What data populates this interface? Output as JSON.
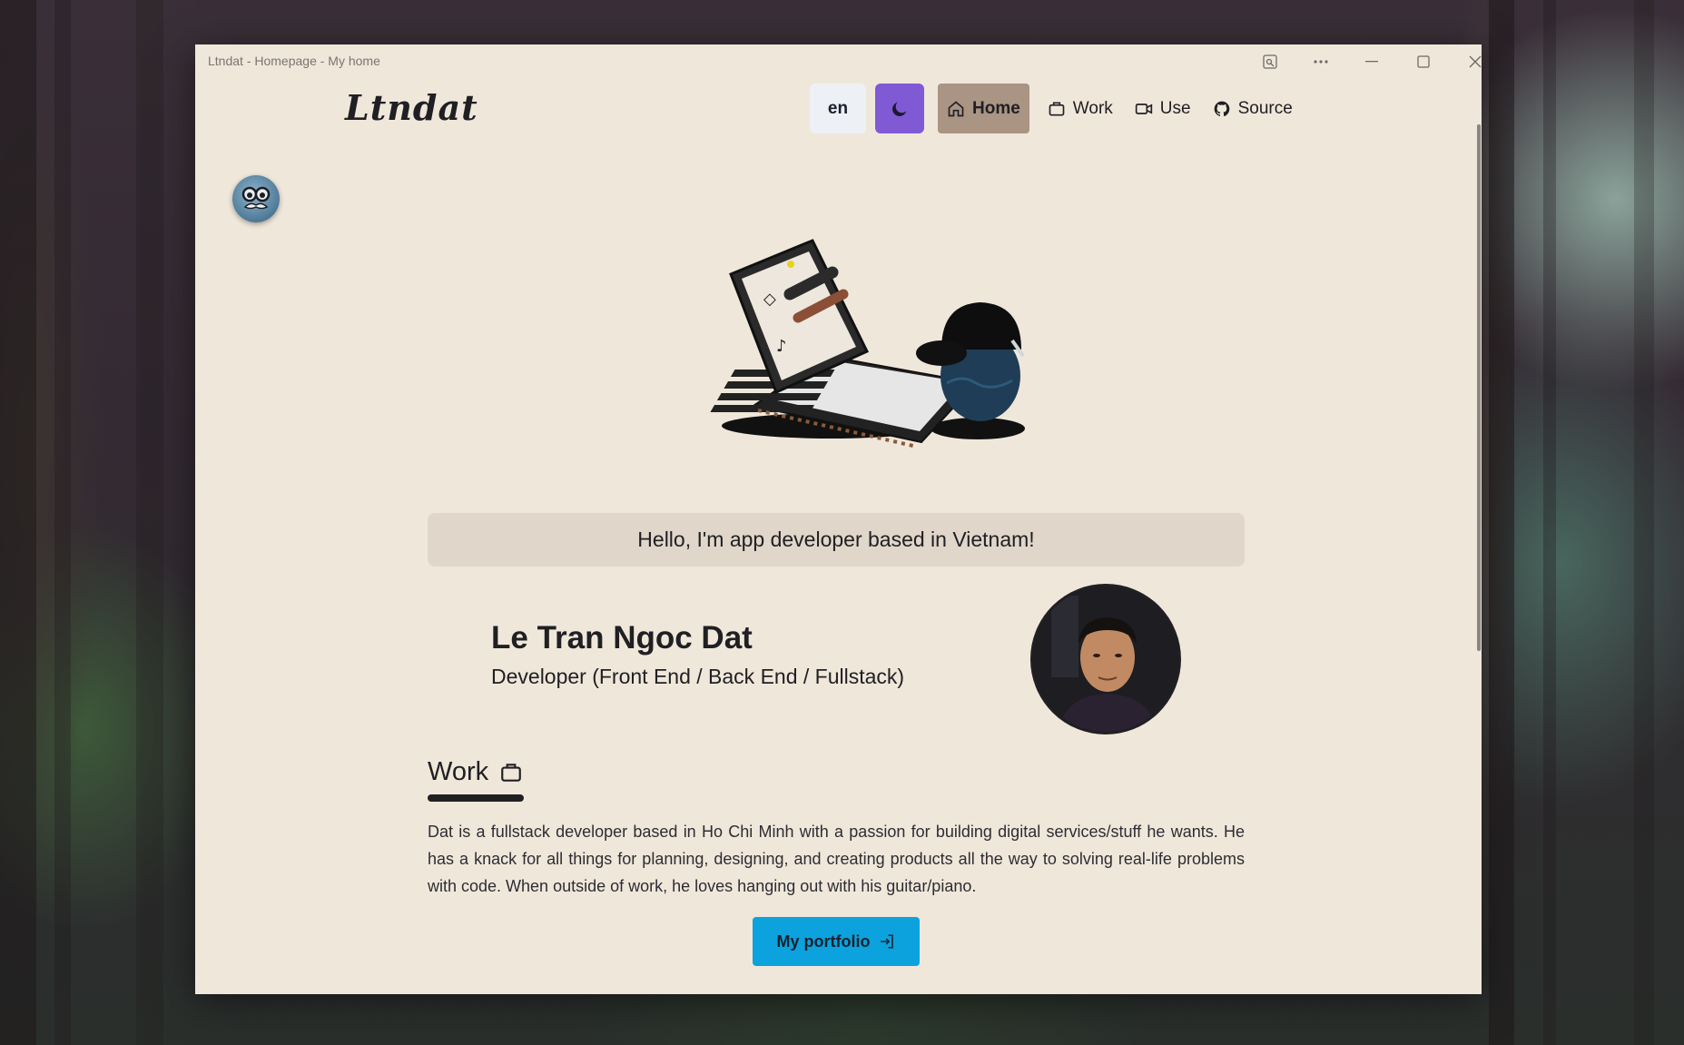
{
  "window": {
    "title": "Ltndat - Homepage - My home"
  },
  "navbar": {
    "logo": "Ltndat",
    "language": "en",
    "links": [
      {
        "label": "Home",
        "icon": "home-icon",
        "active": true
      },
      {
        "label": "Work",
        "icon": "briefcase-icon",
        "active": false
      },
      {
        "label": "Use",
        "icon": "video-icon",
        "active": false
      },
      {
        "label": "Source",
        "icon": "github-icon",
        "active": false
      }
    ]
  },
  "greeting": "Hello, I'm app developer based in Vietnam!",
  "profile": {
    "name": "Le Tran Ngoc Dat",
    "role": "Developer (Front End / Back End / Fullstack)"
  },
  "work_section": {
    "title": "Work",
    "bio": "Dat is a fullstack developer based in Ho Chi Minh with a passion for building digital services/stuff he wants. He has a knack for all things for planning, designing, and creating products all the way to solving real-life problems with code. When outside of work, he loves hanging out with his guitar/piano.",
    "button_label": "My portfolio"
  },
  "colors": {
    "page_bg": "#f0e7db",
    "theme_toggle": "#805ad5",
    "active_nav": "#aa9484",
    "portfolio_button": "#0ba2dd",
    "text": "#202023"
  }
}
